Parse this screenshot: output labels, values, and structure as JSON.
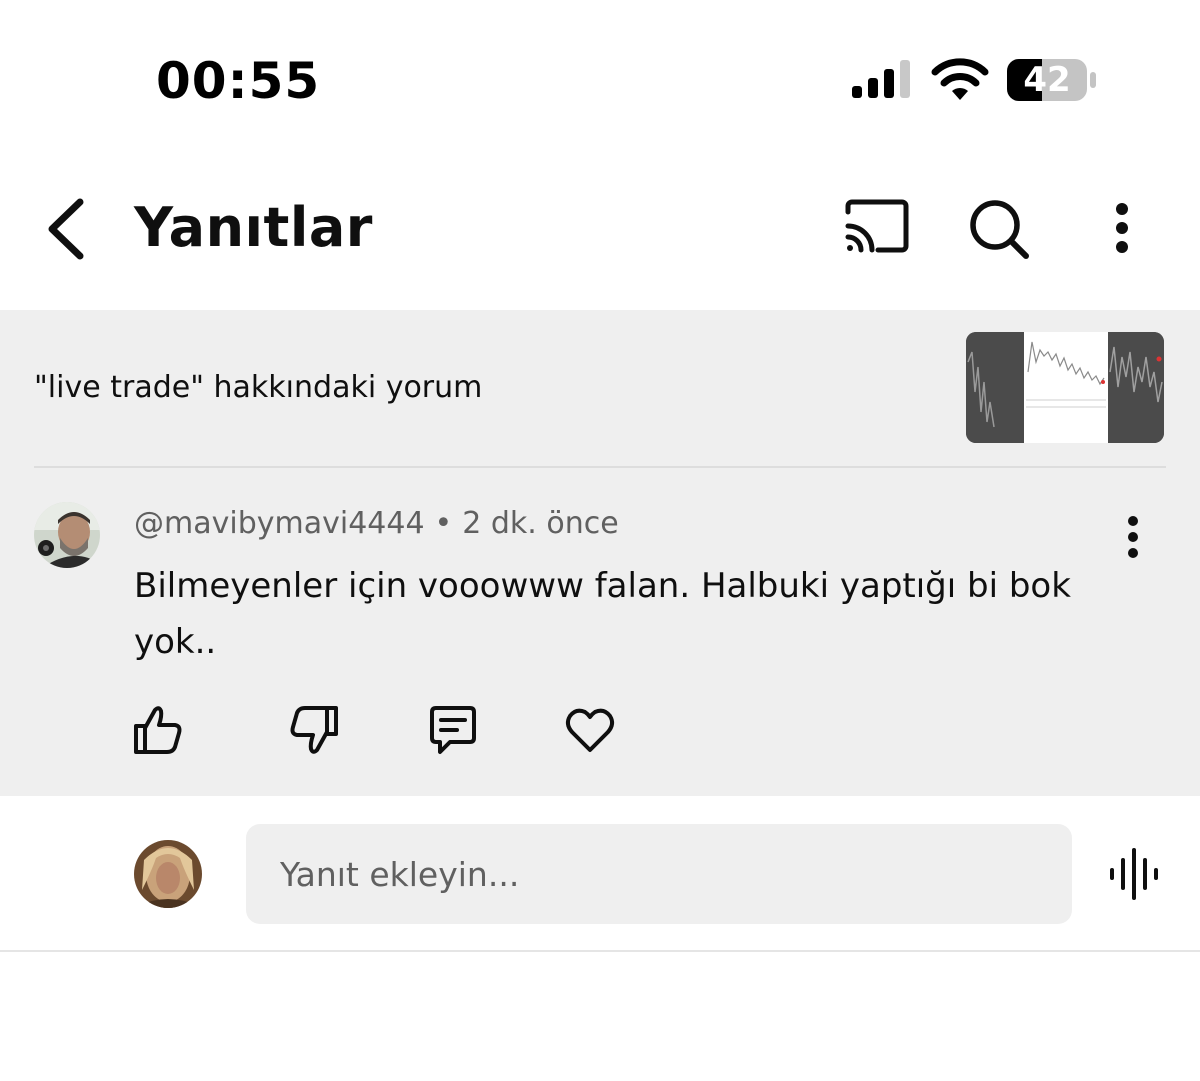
{
  "status_bar": {
    "time": "00:55",
    "battery_level": "42",
    "icons": [
      "cellular-signal-icon",
      "wifi-icon",
      "battery-icon"
    ]
  },
  "header": {
    "title": "Yanıtlar",
    "icons": [
      "back-arrow-icon",
      "cast-icon",
      "search-icon",
      "more-vertical-icon"
    ]
  },
  "context": {
    "text": "\"live trade\" hakkındaki yorum",
    "thumbnail": "video-thumbnail"
  },
  "comment": {
    "author": "@mavibymavi4444",
    "separator": "•",
    "time_ago": "2 dk. önce",
    "text": "Bilmeyenler için vooowww falan. Halbuki yaptığı bi bok yok..",
    "actions": [
      "thumbs-up-icon",
      "thumbs-down-icon",
      "reply-icon",
      "heart-icon"
    ]
  },
  "reply": {
    "placeholder": "Yanıt ekleyin...",
    "icons": [
      "microphone-icon"
    ]
  },
  "colors": {
    "panel_background": "#efefef",
    "secondary_text": "#606060",
    "primary_text": "#0f0f0f"
  }
}
